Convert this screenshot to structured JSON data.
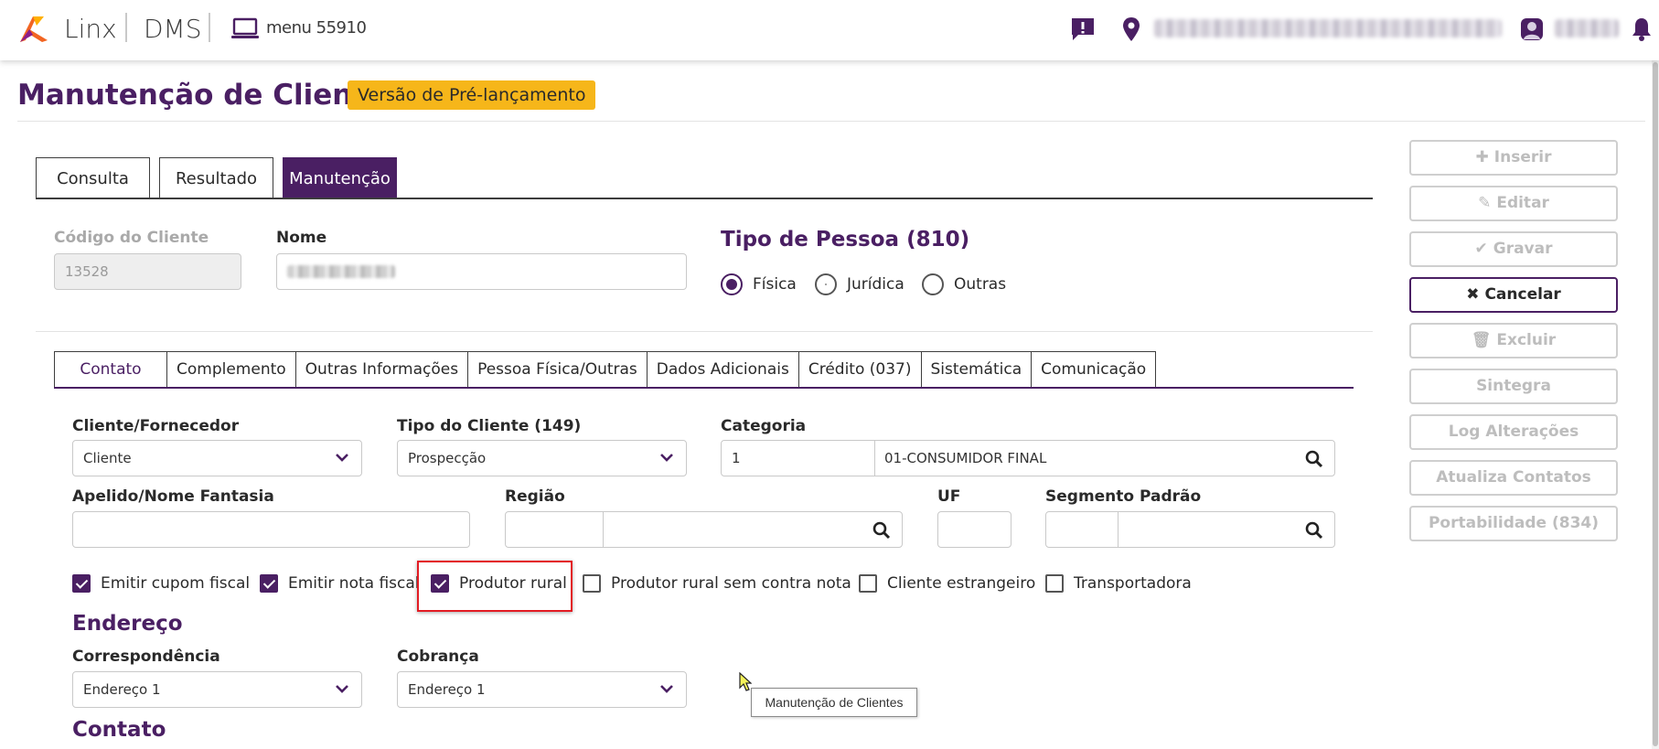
{
  "topbar": {
    "brand": "Linx",
    "product": "DMS",
    "menu_label": "menu 55910",
    "icons": [
      "linx-logo-icon",
      "laptop-icon",
      "message-alert-icon",
      "location-pin-icon",
      "user-avatar-icon",
      "bell-icon"
    ]
  },
  "page": {
    "title": "Manutenção de Clientes",
    "badge": "Versão de Pré-lançamento"
  },
  "main_tabs": [
    {
      "label": "Consulta",
      "active": false
    },
    {
      "label": "Resultado",
      "active": false
    },
    {
      "label": "Manutenção",
      "active": true
    }
  ],
  "header_form": {
    "codigo_label": "Código do Cliente",
    "codigo_value": "13528",
    "nome_label": "Nome",
    "tipo_pessoa_title": "Tipo de Pessoa (810)",
    "tipo_pessoa_options": [
      {
        "label": "Física",
        "selected": true
      },
      {
        "label": "Jurídica",
        "selected": false
      },
      {
        "label": "Outras",
        "selected": false
      }
    ]
  },
  "sub_tabs": [
    {
      "label": "Contato",
      "active": true
    },
    {
      "label": "Complemento",
      "active": false
    },
    {
      "label": "Outras Informações",
      "active": false
    },
    {
      "label": "Pessoa Física/Outras",
      "active": false
    },
    {
      "label": "Dados Adicionais",
      "active": false
    },
    {
      "label": "Crédito (037)",
      "active": false
    },
    {
      "label": "Sistemática",
      "active": false
    },
    {
      "label": "Comunicação",
      "active": false
    }
  ],
  "contato": {
    "cliente_fornecedor_label": "Cliente/Fornecedor",
    "cliente_fornecedor_value": "Cliente",
    "tipo_cliente_label": "Tipo do Cliente (149)",
    "tipo_cliente_value": "Prospecção",
    "categoria_label": "Categoria",
    "categoria_code": "1",
    "categoria_desc": "01-CONSUMIDOR FINAL",
    "apelido_label": "Apelido/Nome Fantasia",
    "apelido_value": "",
    "regiao_label": "Região",
    "uf_label": "UF",
    "segmento_label": "Segmento Padrão"
  },
  "checkboxes": [
    {
      "label": "Emitir cupom fiscal",
      "checked": true
    },
    {
      "label": "Emitir nota fiscal",
      "checked": true
    },
    {
      "label": "Produtor rural",
      "checked": true
    },
    {
      "label": "Produtor rural sem contra nota",
      "checked": false
    },
    {
      "label": "Cliente estrangeiro",
      "checked": false
    },
    {
      "label": "Transportadora",
      "checked": false
    }
  ],
  "endereco": {
    "title": "Endereço",
    "correspondencia_label": "Correspondência",
    "correspondencia_value": "Endereço 1",
    "cobranca_label": "Cobrança",
    "cobranca_value": "Endereço 1"
  },
  "contato_section_title": "Contato",
  "side_buttons": [
    {
      "label": "Inserir",
      "icon": "plus-icon",
      "enabled": false
    },
    {
      "label": "Editar",
      "icon": "edit-icon",
      "enabled": false
    },
    {
      "label": "Gravar",
      "icon": "check-icon",
      "enabled": false
    },
    {
      "label": "Cancelar",
      "icon": "x-icon",
      "enabled": true
    },
    {
      "label": "Excluir",
      "icon": "trash-icon",
      "enabled": false
    },
    {
      "label": "Sintegra",
      "icon": "",
      "enabled": false
    },
    {
      "label": "Log Alterações",
      "icon": "",
      "enabled": false
    },
    {
      "label": "Atualiza Contatos",
      "icon": "",
      "enabled": false
    },
    {
      "label": "Portabilidade (834)",
      "icon": "",
      "enabled": false
    }
  ],
  "tooltip": "Manutenção de Clientes",
  "colors": {
    "brand_purple": "#4a1f63",
    "badge_yellow": "#f6b61a",
    "highlight_red": "#e31b23"
  }
}
